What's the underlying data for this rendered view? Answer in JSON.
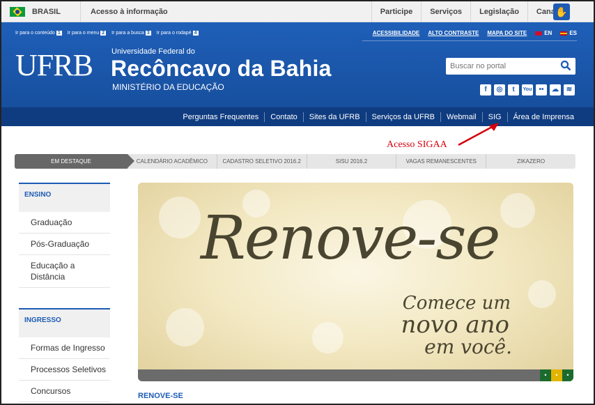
{
  "govbar": {
    "country": "BRASIL",
    "access_info": "Acesso à informação",
    "links": [
      "Participe",
      "Serviços",
      "Legislação",
      "Canais"
    ],
    "libras_icon": "hand-icon"
  },
  "skip_links": [
    {
      "label": "Ir para o conteúdo",
      "key": "1"
    },
    {
      "label": "Ir para o menu",
      "key": "2"
    },
    {
      "label": "Ir para a busca",
      "key": "3"
    },
    {
      "label": "Ir para o rodapé",
      "key": "4"
    }
  ],
  "accessibility": {
    "acessibilidade": "ACESSIBILIDADE",
    "contrast": "ALTO CONTRASTE",
    "sitemap": "MAPA DO SITE",
    "en": "EN",
    "es": "ES"
  },
  "header": {
    "logo": "UFRB",
    "small_title": "Universidade Federal do",
    "big_title": "Recôncavo da Bahia",
    "ministry": "MINISTÉRIO DA EDUCAÇÃO",
    "search_placeholder": "Buscar no portal",
    "social": [
      "f",
      "◎",
      "t",
      "You",
      "••",
      "☁",
      "≋"
    ]
  },
  "nav": [
    "Perguntas Frequentes",
    "Contato",
    "Sites da UFRB",
    "Serviços da UFRB",
    "Webmail",
    "SIG",
    "Área de Imprensa"
  ],
  "annotation": "Acesso SIGAA",
  "tabs": [
    "EM DESTAQUE",
    "CALENDÁRIO ACADÊMICO",
    "CADASTRO SELETIVO 2016.2",
    "SISU 2016.2",
    "VAGAS REMANESCENTES",
    "ZIKAZERO"
  ],
  "sidebar": {
    "ensino": {
      "title": "ENSINO",
      "items": [
        "Graduação",
        "Pós-Graduação",
        "Educação a Distância"
      ]
    },
    "ingresso": {
      "title": "INGRESSO",
      "items": [
        "Formas de Ingresso",
        "Processos Seletivos",
        "Concursos"
      ]
    }
  },
  "banner": {
    "headline": "Renove-se",
    "line1": "Comece um",
    "line2": "novo ano",
    "line3": "em você.",
    "slider_dots": [
      "•",
      "•",
      "•"
    ]
  },
  "caption": "RENOVE-SE",
  "colors": {
    "primary": "#1c5bb4",
    "navbar": "#0f3c80",
    "annotation": "#d4000c"
  }
}
